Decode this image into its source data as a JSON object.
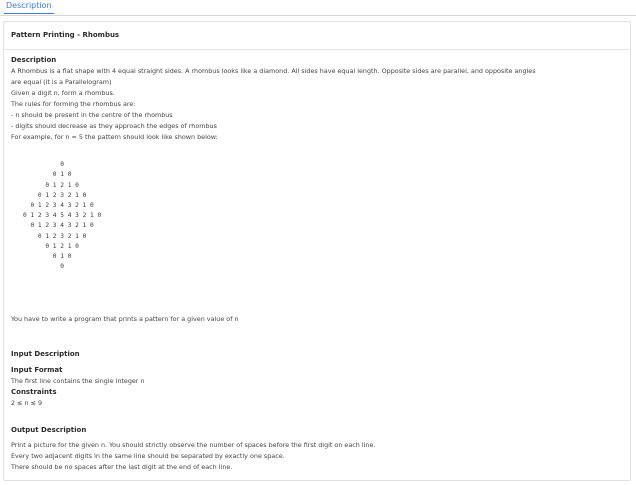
{
  "tab": {
    "label": "Description"
  },
  "problem": {
    "title": "Pattern Printing - Rhombus"
  },
  "description": {
    "heading": "Description",
    "lines": [
      "A Rhombus is a flat shape with 4 equal straight sides. A rhombus looks like a diamond. All sides have equal length. Opposite sides are parallel, and opposite angles",
      "are equal (it is a Parallelogram)",
      "Given a digit n, form a rhombus.",
      "The rules for forming the rhombus are:",
      "- n should be present in the centre of the rhombus",
      "- digits should decrease as they approach the edges of rhombus",
      "For example, for n = 5 the pattern should look like shown below:"
    ],
    "pattern": [
      "          0",
      "        0 1 0",
      "      0 1 2 1 0",
      "    0 1 2 3 2 1 0",
      "  0 1 2 3 4 3 2 1 0",
      "0 1 2 3 4 5 4 3 2 1 0",
      "  0 1 2 3 4 3 2 1 0",
      "    0 1 2 3 2 1 0",
      "      0 1 2 1 0",
      "        0 1 0",
      "          0"
    ],
    "task": "You have to write a program that prints a pattern for a given value of n"
  },
  "input": {
    "heading": "Input Description",
    "format_heading": "Input Format",
    "format_text": "The first line contains the single integer n",
    "constraints_heading": "Constraints",
    "constraints_text": "2 ≤ n ≤ 9"
  },
  "output": {
    "heading": "Output Description",
    "lines": [
      "Print a picture for the given n. You should strictly observe the number of spaces before the first digit on each line.",
      "Every two adjacent digits in the same line should be separated by exactly one space.",
      "There should be no spaces after the last digit at the end of each line."
    ]
  }
}
